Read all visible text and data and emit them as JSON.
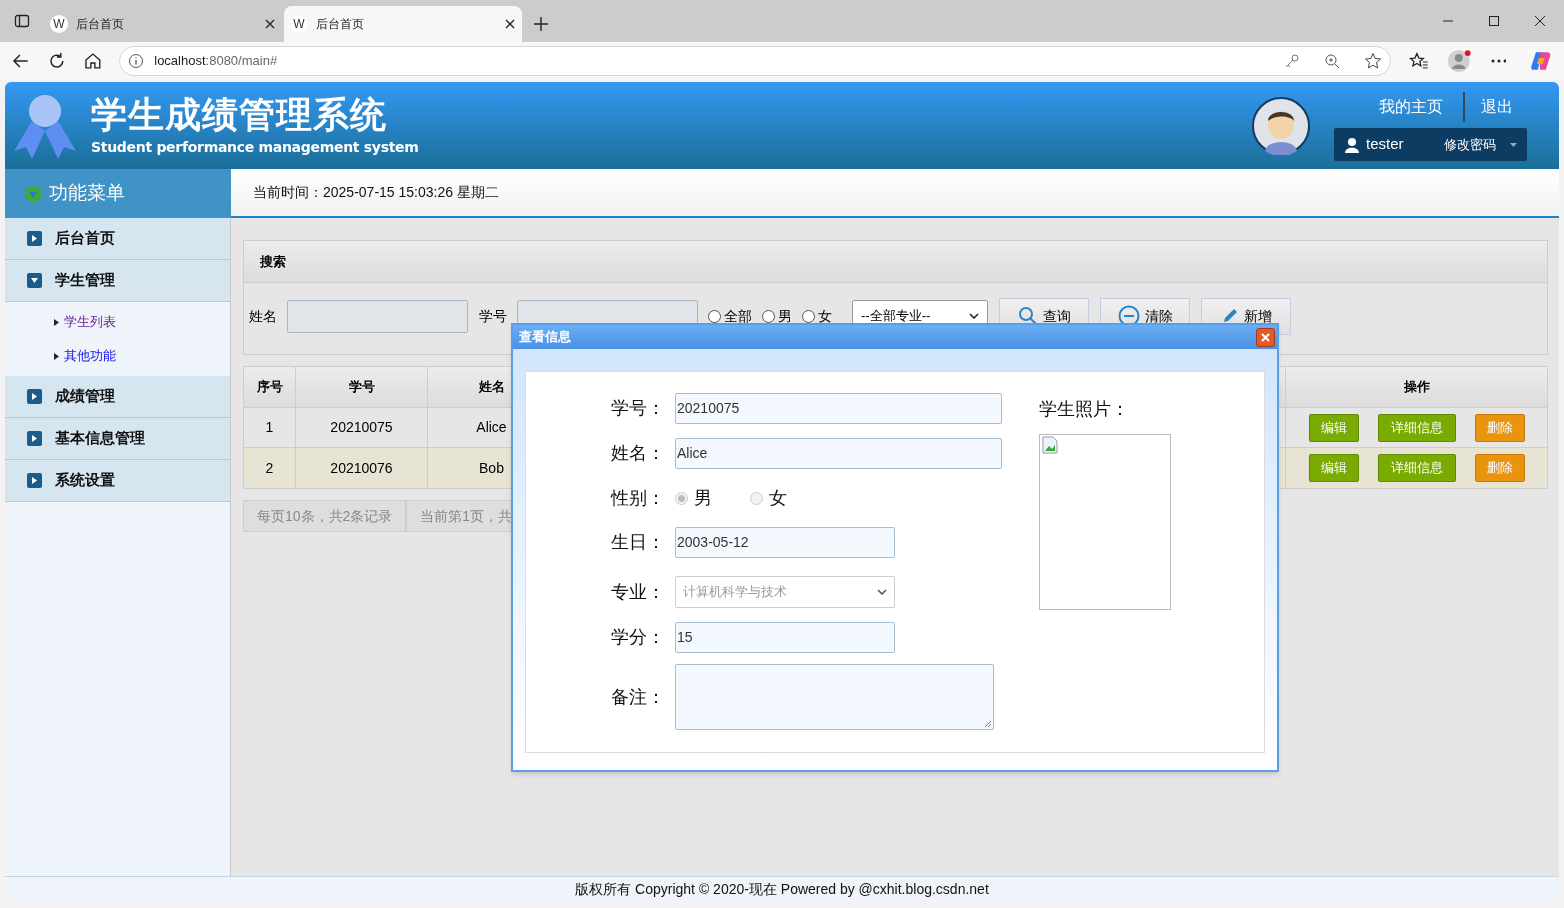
{
  "browser": {
    "tabs": [
      {
        "icon": "W",
        "title": "后台首页",
        "selected": false
      },
      {
        "icon": "W",
        "title": "后台首页",
        "selected": true
      }
    ],
    "url_host": "localhost",
    "url_rest": ":8080/main#"
  },
  "header": {
    "title": "学生成绩管理系统",
    "subtitle": "Student performance management system",
    "links": [
      "我的主页",
      "退出"
    ],
    "user": "tester",
    "user_menu": "修改密码"
  },
  "menu_title": "功能菜单",
  "current_time": "当前时间：2025-07-15 15:03:26 星期二",
  "sidebar": [
    {
      "label": "后台首页",
      "expanded": false
    },
    {
      "label": "学生管理",
      "expanded": true,
      "children": [
        {
          "label": "学生列表",
          "visited": true
        },
        {
          "label": "其他功能",
          "visited": false
        }
      ]
    },
    {
      "label": "成绩管理",
      "expanded": false
    },
    {
      "label": "基本信息管理",
      "expanded": false
    },
    {
      "label": "系统设置",
      "expanded": false
    }
  ],
  "search": {
    "title": "搜索",
    "fields": [
      "姓名",
      "学号"
    ],
    "gender_options": [
      {
        "label": "全部",
        "selected": false
      },
      {
        "label": "男",
        "selected": false
      },
      {
        "label": "女",
        "selected": false
      }
    ],
    "major_select": "--全部专业--",
    "buttons": [
      {
        "kind": "search",
        "label": "查询"
      },
      {
        "kind": "clear",
        "label": "清除"
      },
      {
        "kind": "add",
        "label": "新增"
      }
    ]
  },
  "table": {
    "columns": [
      "序号",
      "学号",
      "姓名"
    ],
    "actions_column": "操作",
    "rows": [
      {
        "cells": [
          "1",
          "20210075",
          "Alice"
        ],
        "highlighted": false,
        "actions": [
          {
            "kind": "edit",
            "label": "编辑"
          },
          {
            "kind": "detail",
            "label": "详细信息"
          },
          {
            "kind": "delete",
            "label": "删除"
          }
        ]
      },
      {
        "cells": [
          "2",
          "20210076",
          "Bob"
        ],
        "highlighted": true,
        "actions": [
          {
            "kind": "edit",
            "label": "编辑"
          },
          {
            "kind": "detail",
            "label": "详细信息"
          },
          {
            "kind": "delete",
            "label": "删除"
          }
        ]
      }
    ]
  },
  "pagination": [
    "每页10条，共2条记录",
    "当前第1页，共"
  ],
  "dialog": {
    "title": "查看信息",
    "photo_label": "学生照片：",
    "fields": [
      {
        "kind": "text",
        "label": "学号：",
        "value": "20210075",
        "wide": true
      },
      {
        "kind": "text",
        "label": "姓名：",
        "value": "Alice",
        "wide": true
      },
      {
        "kind": "radio",
        "label": "性别：",
        "options": [
          {
            "label": "男",
            "selected": true
          },
          {
            "label": "女",
            "selected": false
          }
        ]
      },
      {
        "kind": "text",
        "label": "生日：",
        "value": "2003-05-12",
        "wide": false
      },
      {
        "kind": "select",
        "label": "专业：",
        "value": "计算机科学与技术",
        "wide": false
      },
      {
        "kind": "text",
        "label": "学分：",
        "value": "15",
        "wide": false
      },
      {
        "kind": "textarea",
        "label": "备注："
      }
    ]
  },
  "footer": "版权所有 Copyright © 2020-现在 Powered by @cxhit.blog.csdn.net"
}
